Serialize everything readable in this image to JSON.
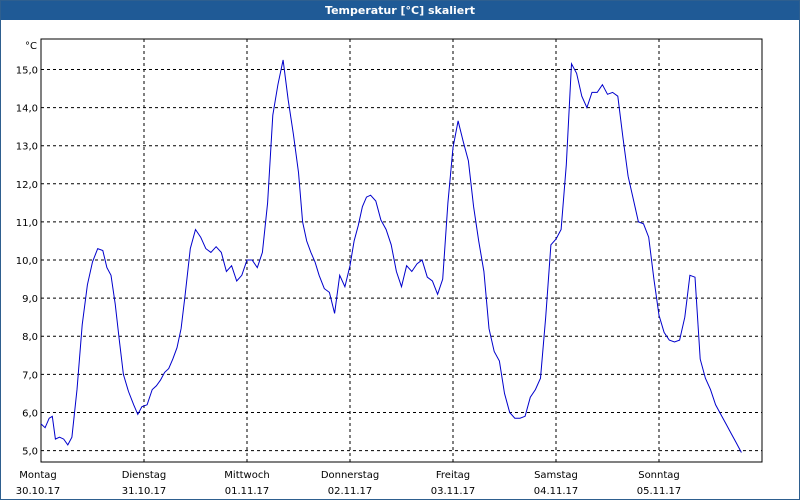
{
  "window": {
    "title": "Temperatur [°C] skaliert"
  },
  "chart_data": {
    "type": "line",
    "title": "Temperatur [°C] skaliert",
    "ylabel": "°C",
    "xlabel": "",
    "ylim": [
      4.7,
      15.8
    ],
    "yticks": [
      "5,0",
      "6,0",
      "7,0",
      "8,0",
      "9,0",
      "10,0",
      "11,0",
      "12,0",
      "13,0",
      "14,0",
      "15,0"
    ],
    "grid": true,
    "line_color": "#0000cc",
    "x_labels": [
      {
        "day": "Montag",
        "date": "30.10.17"
      },
      {
        "day": "Dienstag",
        "date": "31.10.17"
      },
      {
        "day": "Mittwoch",
        "date": "01.11.17"
      },
      {
        "day": "Donnerstag",
        "date": "02.11.17"
      },
      {
        "day": "Freitag",
        "date": "03.11.17"
      },
      {
        "day": "Samstag",
        "date": "04.11.17"
      },
      {
        "day": "Sonntag",
        "date": "05.11.17"
      }
    ],
    "series": [
      {
        "x_days": [
          0.0,
          0.04,
          0.08,
          0.11,
          0.14,
          0.18,
          0.22,
          0.26,
          0.3,
          0.35,
          0.4,
          0.45,
          0.5,
          0.55,
          0.6,
          0.64,
          0.68,
          0.72,
          0.76,
          0.8,
          0.85,
          0.9,
          0.94,
          0.98,
          1.03,
          1.08,
          1.12,
          1.16,
          1.2,
          1.24,
          1.28,
          1.32,
          1.36,
          1.4,
          1.45,
          1.5,
          1.55,
          1.6,
          1.65,
          1.7,
          1.75,
          1.8,
          1.85,
          1.9,
          1.95,
          2.0,
          2.05,
          2.1,
          2.15,
          2.2,
          2.25,
          2.3,
          2.35,
          2.4,
          2.45,
          2.5,
          2.54,
          2.58,
          2.62,
          2.66,
          2.7,
          2.75,
          2.8,
          2.85,
          2.9,
          2.95,
          3.0,
          3.04,
          3.08,
          3.12,
          3.16,
          3.2,
          3.25,
          3.3,
          3.35,
          3.4,
          3.45,
          3.5,
          3.55,
          3.6,
          3.65,
          3.7,
          3.75,
          3.8,
          3.85,
          3.9,
          3.95,
          4.0,
          4.05,
          4.1,
          4.15,
          4.2,
          4.25,
          4.3,
          4.35,
          4.4,
          4.45,
          4.5,
          4.55,
          4.6,
          4.65,
          4.7,
          4.75,
          4.8,
          4.85,
          4.9,
          4.95,
          5.0,
          5.05,
          5.1,
          5.15,
          5.2,
          5.25,
          5.3,
          5.35,
          5.4,
          5.45,
          5.5,
          5.55,
          5.6,
          5.65,
          5.7,
          5.75,
          5.8,
          5.85,
          5.9,
          5.95,
          6.0,
          6.05,
          6.1,
          6.15,
          6.2,
          6.25,
          6.3,
          6.35,
          6.4,
          6.45,
          6.5,
          6.55,
          6.6,
          6.65,
          6.7,
          6.75,
          6.8,
          6.85,
          6.9,
          6.95,
          7.0
        ],
        "y": [
          5.7,
          5.6,
          5.85,
          5.9,
          5.3,
          5.35,
          5.3,
          5.15,
          5.35,
          6.6,
          8.3,
          9.35,
          9.95,
          10.3,
          10.25,
          9.8,
          9.6,
          8.85,
          7.9,
          7.0,
          6.55,
          6.2,
          5.95,
          6.15,
          6.2,
          6.6,
          6.7,
          6.85,
          7.05,
          7.15,
          7.4,
          7.7,
          8.2,
          9.1,
          10.3,
          10.8,
          10.6,
          10.3,
          10.2,
          10.35,
          10.2,
          9.7,
          9.85,
          9.45,
          9.6,
          10.0,
          10.0,
          9.8,
          10.2,
          11.5,
          13.8,
          14.6,
          15.25,
          14.2,
          13.3,
          12.3,
          11.0,
          10.5,
          10.2,
          9.95,
          9.6,
          9.25,
          9.15,
          8.6,
          9.6,
          9.3,
          9.85,
          10.5,
          10.9,
          11.4,
          11.65,
          11.7,
          11.55,
          11.05,
          10.8,
          10.4,
          9.7,
          9.3,
          9.85,
          9.7,
          9.9,
          10.0,
          9.55,
          9.45,
          9.1,
          9.5,
          11.5,
          12.95,
          13.65,
          13.1,
          12.6,
          11.4,
          10.5,
          9.7,
          8.2,
          7.6,
          7.35,
          6.5,
          6.0,
          5.85,
          5.85,
          5.9,
          6.4,
          6.6,
          6.9,
          8.5,
          10.4,
          10.55,
          10.8,
          12.5,
          15.15,
          14.9,
          14.3,
          14.0,
          14.4,
          14.4,
          14.6,
          14.35,
          14.4,
          14.3,
          13.2,
          12.2,
          11.6,
          11.0,
          10.95,
          10.6,
          9.5,
          8.55,
          8.1,
          7.9,
          7.85,
          7.9,
          8.5,
          9.6,
          9.55,
          7.4,
          6.9,
          6.6,
          6.2,
          5.95,
          5.7,
          5.45,
          5.2,
          4.95
        ]
      }
    ]
  }
}
